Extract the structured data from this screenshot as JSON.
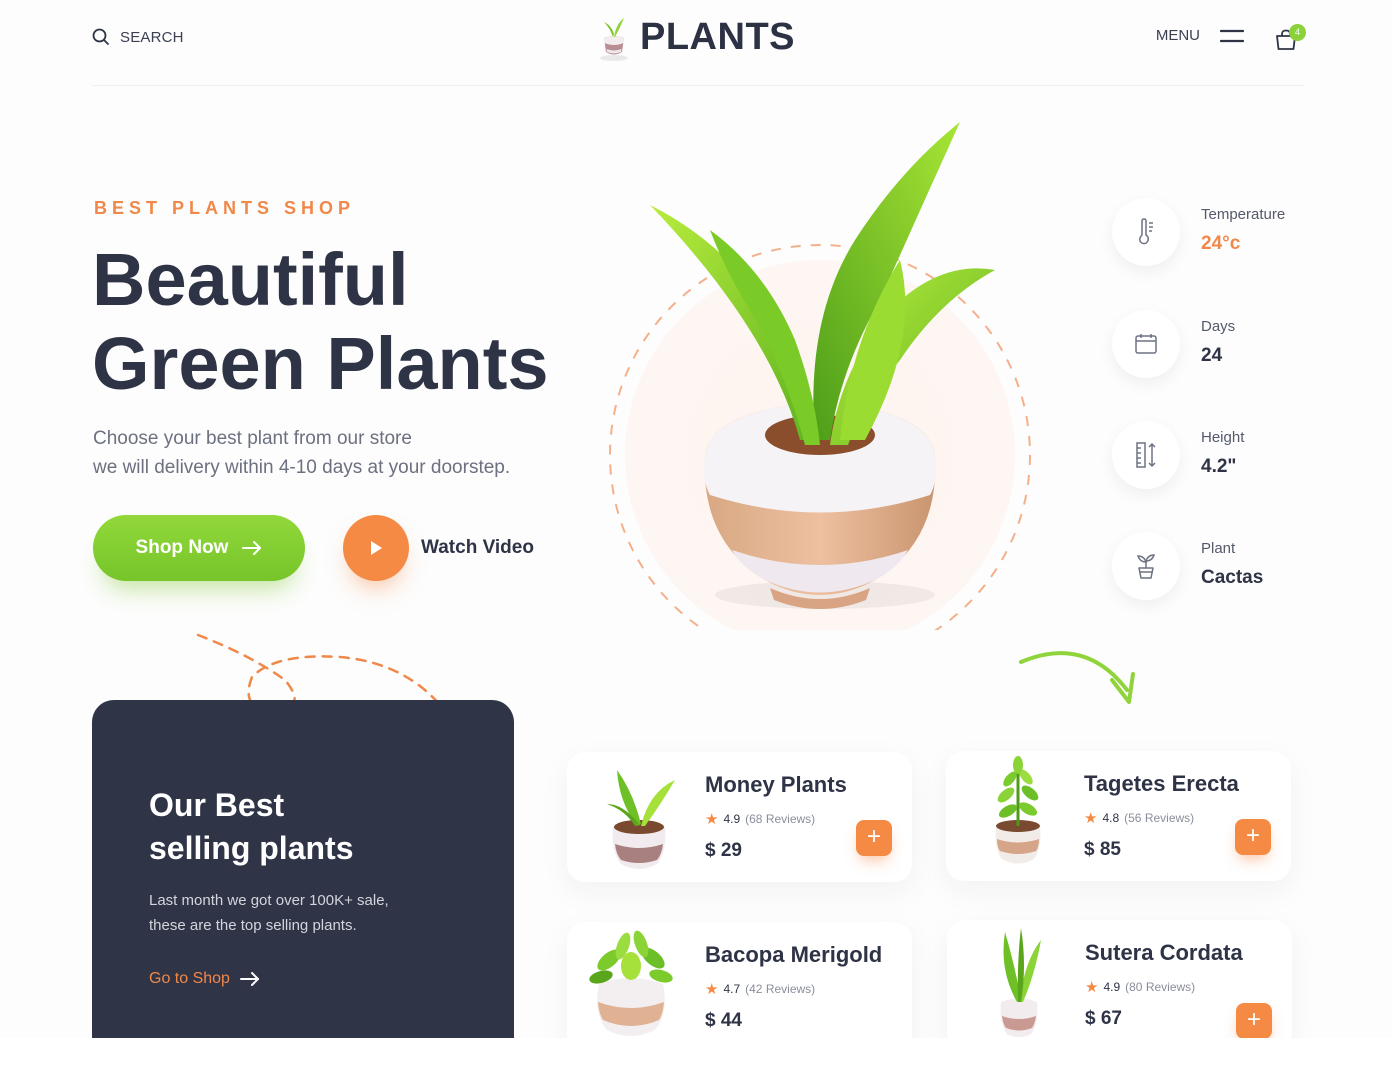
{
  "header": {
    "search_label": "SEARCH",
    "logo_text": "PLANTS",
    "menu_label": "MENU",
    "cart_count": "4"
  },
  "hero": {
    "eyebrow": "BEST PLANTS SHOP",
    "title_line1": "Beautiful",
    "title_line2": "Green Plants",
    "desc_line1": "Choose your best plant from our store",
    "desc_line2": "we will delivery within 4-10 days at your doorstep.",
    "shop_now_label": "Shop Now",
    "watch_video_label": "Watch Video"
  },
  "stats": [
    {
      "label": "Temperature",
      "value": "24°c"
    },
    {
      "label": "Days",
      "value": "24"
    },
    {
      "label": "Height",
      "value": "4.2\""
    },
    {
      "label": "Plant",
      "value": "Cactas"
    }
  ],
  "best_card": {
    "title_line1": "Our Best",
    "title_line2": "selling plants",
    "desc_line1": "Last month we got over 100K+ sale,",
    "desc_line2": "these are the top selling plants.",
    "link_label": "Go to Shop"
  },
  "products": [
    {
      "name": "Money Plants",
      "rating": "4.9",
      "reviews": "(68 Reviews)",
      "price": "$ 29"
    },
    {
      "name": "Tagetes Erecta",
      "rating": "4.8",
      "reviews": "(56 Reviews)",
      "price": "$ 85"
    },
    {
      "name": "Bacopa Merigold",
      "rating": "4.7",
      "reviews": "(42 Reviews)",
      "price": "$ 44"
    },
    {
      "name": "Sutera Cordata",
      "rating": "4.9",
      "reviews": "(80 Reviews)",
      "price": "$ 67"
    }
  ],
  "colors": {
    "accent_orange": "#f58a45",
    "accent_green": "#7fcb2e",
    "dark": "#2f3447"
  }
}
